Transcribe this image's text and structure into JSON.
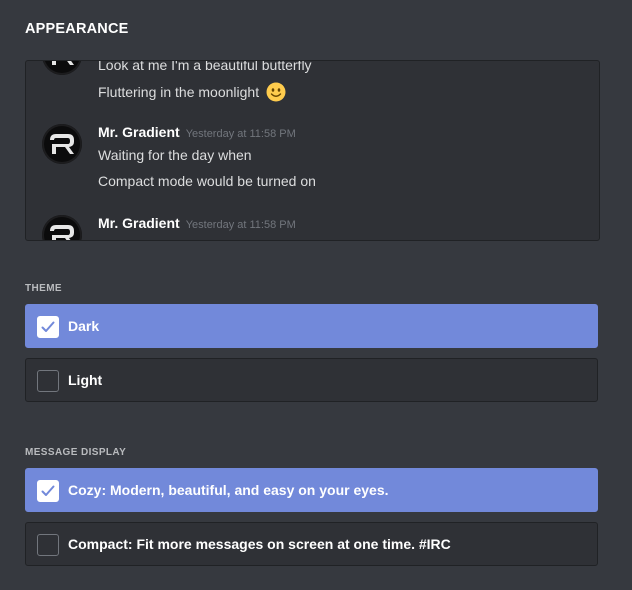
{
  "page": {
    "title": "APPEARANCE"
  },
  "preview": {
    "group1": {
      "lines": [
        "Look at me I'm a beautiful butterfly",
        "Fluttering in the moonlight"
      ],
      "emoji": "smiling-face-emoji"
    },
    "group2": {
      "author": "Mr. Gradient",
      "timestamp": "Yesterday at 11:58 PM",
      "lines": [
        "Waiting for the day when",
        "Compact mode would be turned on"
      ]
    },
    "group3": {
      "author": "Mr. Gradient",
      "timestamp": "Yesterday at 11:58 PM"
    }
  },
  "theme": {
    "label": "THEME",
    "options": [
      {
        "label": "Dark",
        "checked": true
      },
      {
        "label": "Light",
        "checked": false
      }
    ]
  },
  "message_display": {
    "label": "MESSAGE DISPLAY",
    "options": [
      {
        "label": "Cozy: Modern, beautiful, and easy on your eyes.",
        "checked": true
      },
      {
        "label": "Compact: Fit more messages on screen at one time. #IRC",
        "checked": false
      }
    ]
  },
  "colors": {
    "background": "#36393f",
    "panel": "#2f3136",
    "accent": "#7289da",
    "text": "#dcddde",
    "muted": "#72767d"
  }
}
